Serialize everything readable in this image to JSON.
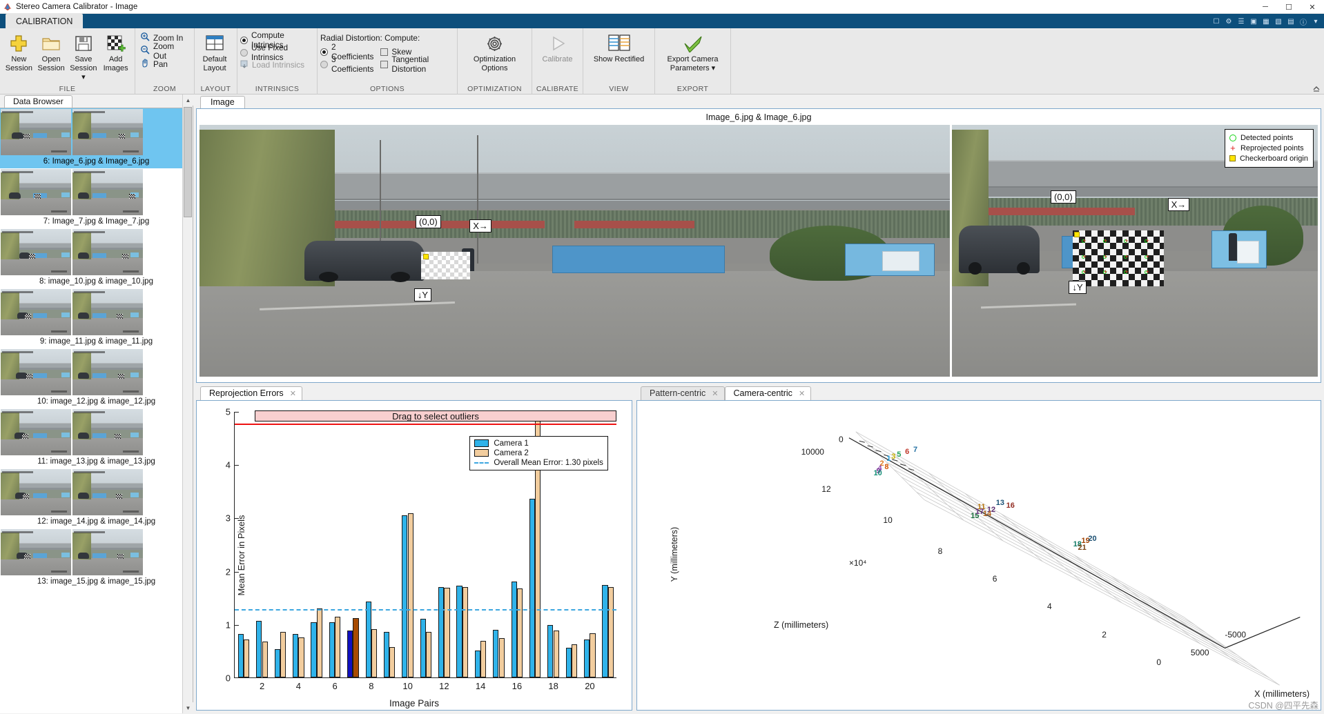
{
  "window": {
    "title": "Stereo Camera Calibrator - Image",
    "minimize": "─",
    "maximize": "☐",
    "close": "✕"
  },
  "ribbon": {
    "tab": "CALIBRATION",
    "groups": [
      {
        "label": "FILE",
        "buttons": [
          {
            "name": "new-session",
            "line1": "New",
            "line2": "Session",
            "icon": "plus-icon"
          },
          {
            "name": "open-session",
            "line1": "Open",
            "line2": "Session",
            "icon": "folder-icon"
          },
          {
            "name": "save-session",
            "line1": "Save",
            "line2": "Session ▾",
            "icon": "save-icon"
          },
          {
            "name": "add-images",
            "line1": "Add",
            "line2": "Images",
            "icon": "add-images-icon"
          }
        ]
      },
      {
        "label": "ZOOM",
        "items": [
          {
            "name": "zoom-in",
            "label": "Zoom In",
            "icon": "zoom-in-icon"
          },
          {
            "name": "zoom-out",
            "label": "Zoom Out",
            "icon": "zoom-out-icon"
          },
          {
            "name": "pan",
            "label": "Pan",
            "icon": "hand-icon"
          }
        ]
      },
      {
        "label": "LAYOUT",
        "buttons": [
          {
            "name": "default-layout",
            "line1": "Default",
            "line2": "Layout",
            "icon": "layout-icon"
          }
        ]
      },
      {
        "label": "INTRINSICS",
        "options": [
          {
            "name": "compute-intrinsics",
            "label": "Compute Intrinsics",
            "type": "radio",
            "checked": true
          },
          {
            "name": "use-fixed-intrinsics",
            "label": "Use Fixed Intrinsics",
            "type": "radio",
            "checked": false
          },
          {
            "name": "load-intrinsics",
            "label": "Load Intrinsics",
            "type": "button",
            "disabled": true
          }
        ]
      },
      {
        "label": "OPTIONS",
        "heading": "Radial Distortion: Compute:",
        "options": [
          {
            "name": "two-coefficients",
            "label": "2 Coefficients",
            "type": "radio",
            "checked": true
          },
          {
            "name": "three-coefficients",
            "label": "3 Coefficients",
            "type": "radio",
            "checked": false
          },
          {
            "name": "skew",
            "label": "Skew",
            "type": "checkbox",
            "checked": false
          },
          {
            "name": "tangential-distortion",
            "label": "Tangential Distortion",
            "type": "checkbox",
            "checked": false
          }
        ]
      },
      {
        "label": "OPTIMIZATION",
        "buttons": [
          {
            "name": "optimization-options",
            "line1": "Optimization",
            "line2": "Options",
            "icon": "gear-icon"
          }
        ]
      },
      {
        "label": "CALIBRATE",
        "buttons": [
          {
            "name": "calibrate",
            "line1": "Calibrate",
            "line2": "",
            "icon": "play-icon",
            "disabled": true
          }
        ]
      },
      {
        "label": "VIEW",
        "buttons": [
          {
            "name": "show-rectified",
            "line1": "Show Rectified",
            "line2": "",
            "icon": "rectified-icon"
          }
        ]
      },
      {
        "label": "EXPORT",
        "buttons": [
          {
            "name": "export-camera-parameters",
            "line1": "Export Camera",
            "line2": "Parameters ▾",
            "icon": "check-icon"
          }
        ]
      }
    ]
  },
  "browser": {
    "tab": "Data Browser",
    "items": [
      {
        "caption": "6: Image_6.jpg & Image_6.jpg",
        "selected": true
      },
      {
        "caption": "7: Image_7.jpg & Image_7.jpg",
        "selected": false
      },
      {
        "caption": "8: image_10.jpg & image_10.jpg",
        "selected": false
      },
      {
        "caption": "9: image_11.jpg & image_11.jpg",
        "selected": false
      },
      {
        "caption": "10: image_12.jpg & image_12.jpg",
        "selected": false
      },
      {
        "caption": "11: image_13.jpg & image_13.jpg",
        "selected": false
      },
      {
        "caption": "12: image_14.jpg & image_14.jpg",
        "selected": false
      },
      {
        "caption": "13: image_15.jpg & image_15.jpg",
        "selected": false
      }
    ]
  },
  "image_panel": {
    "tab": "Image",
    "title": "Image_6.jpg & Image_6.jpg",
    "annotations": {
      "origin": "(0,0)",
      "x_axis": "X→",
      "y_axis": "↓Y"
    },
    "legend": [
      {
        "name": "detected-points",
        "label": "Detected points",
        "marker": "circle",
        "color": "#16d416"
      },
      {
        "name": "reprojected-points",
        "label": "Reprojected points",
        "marker": "cross",
        "color": "#e02020"
      },
      {
        "name": "checkerboard-origin",
        "label": "Checkerboard origin",
        "marker": "square",
        "color": "#ffe600"
      }
    ]
  },
  "bottom_left": {
    "tab": "Reprojection Errors"
  },
  "bottom_right": {
    "tabs": [
      {
        "name": "tab-pattern-centric",
        "label": "Pattern-centric",
        "active": false
      },
      {
        "name": "tab-camera-centric",
        "label": "Camera-centric",
        "active": true
      }
    ]
  },
  "watermark": "CSDN @四平先森",
  "chart_data": [
    {
      "type": "bar",
      "title": "",
      "xlabel": "Image Pairs",
      "ylabel": "Mean Error in Pixels",
      "ylim": [
        0,
        5
      ],
      "yticks": [
        0,
        1,
        2,
        3,
        4,
        5
      ],
      "xticks": [
        2,
        4,
        6,
        8,
        10,
        12,
        14,
        16,
        18,
        20
      ],
      "categories": [
        1,
        2,
        3,
        4,
        5,
        6,
        7,
        8,
        9,
        10,
        11,
        12,
        13,
        14,
        15,
        16,
        17,
        18,
        19,
        20,
        21
      ],
      "series": [
        {
          "name": "Camera 1",
          "color": "#2fb3ea",
          "values": [
            0.82,
            1.06,
            0.53,
            0.81,
            1.04,
            1.04,
            0.88,
            1.43,
            0.85,
            3.05,
            1.1,
            1.7,
            1.72,
            0.51,
            0.9,
            1.8,
            3.35,
            0.98,
            0.56,
            0.71,
            1.73
          ]
        },
        {
          "name": "Camera 2",
          "color": "#f2cd9e",
          "values": [
            0.71,
            0.68,
            0.86,
            0.75,
            1.3,
            1.14,
            1.12,
            0.91,
            0.57,
            3.08,
            0.86,
            1.68,
            1.7,
            0.69,
            0.74,
            1.67,
            4.87,
            0.88,
            0.62,
            0.83,
            1.7
          ]
        }
      ],
      "highlighted_index": 6,
      "highlight_colors": {
        "camera1": "#1010c0",
        "camera2": "#a84b00"
      },
      "mean_line": {
        "label": "Overall Mean Error: 1.30 pixels",
        "value": 1.3,
        "color": "#3ca7e0"
      },
      "legend": [
        "Camera 1",
        "Camera 2",
        "Overall Mean Error: 1.30 pixels"
      ],
      "outlier_selector": {
        "label": "Drag to select outliers",
        "threshold": 4.78,
        "color": "#ee1111"
      }
    },
    {
      "type": "scatter",
      "subtype": "3d-camera-centric",
      "xlabel": "X (millimeters)",
      "ylabel": "Y (millimeters)",
      "zlabel": "Z (millimeters)",
      "y_ticks": [
        "0",
        "10000"
      ],
      "z_ticks": [
        "12",
        "10",
        "8",
        "6",
        "4",
        "2",
        "0"
      ],
      "z_exponent": "×10⁴",
      "x_ticks": [
        "-5000",
        "5000"
      ],
      "point_labels": [
        "1",
        "2",
        "3",
        "4",
        "5",
        "6",
        "7",
        "8",
        "9",
        "10",
        "11",
        "12",
        "13",
        "14",
        "15",
        "16",
        "17",
        "18",
        "19",
        "20",
        "21"
      ]
    }
  ]
}
